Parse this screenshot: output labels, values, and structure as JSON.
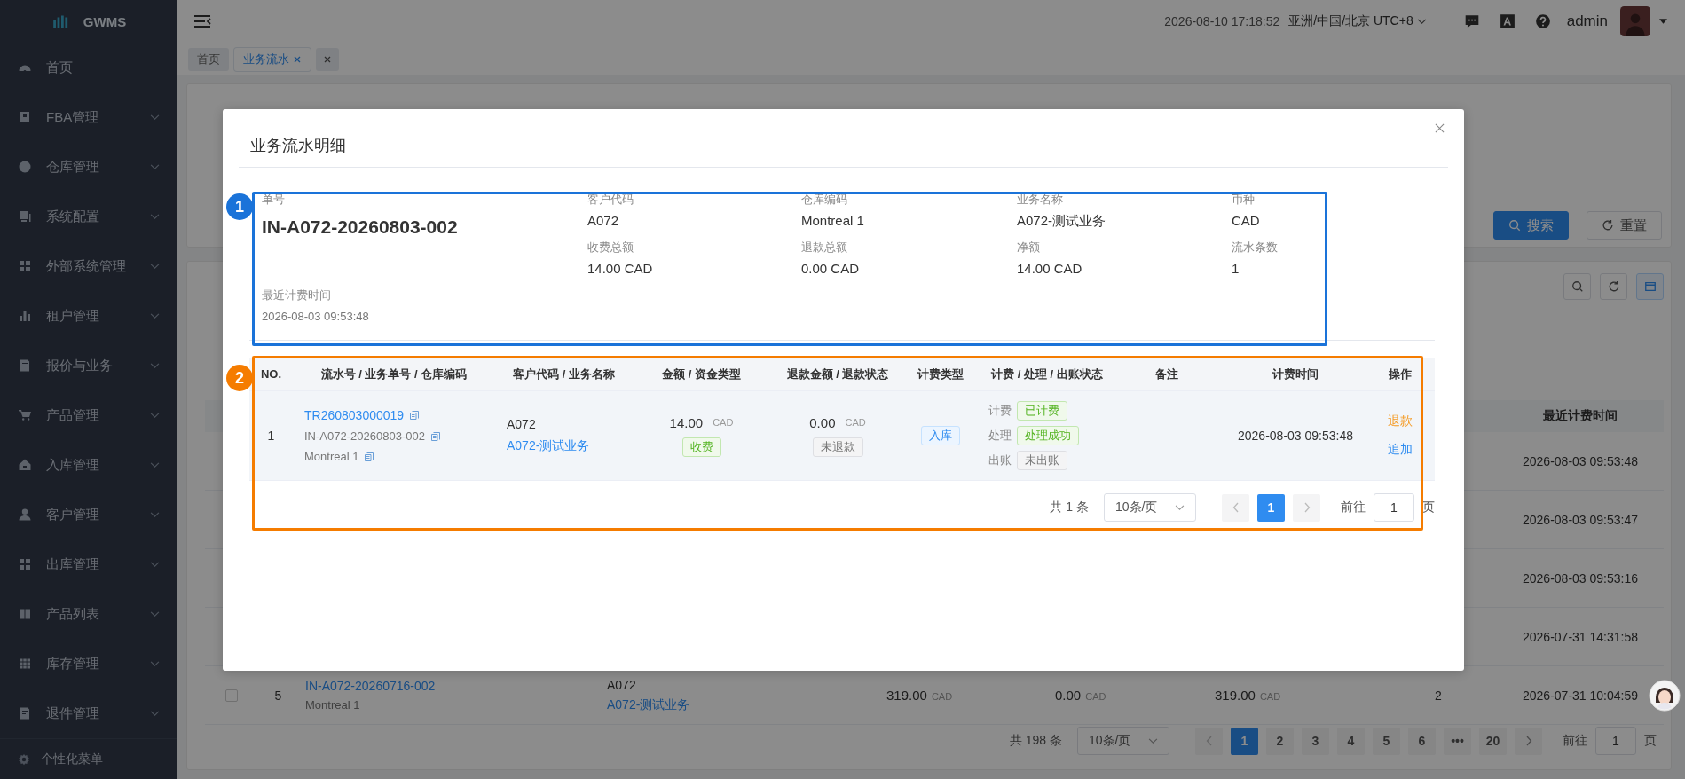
{
  "sidebar": {
    "logo": "GWMS",
    "items": [
      {
        "label": "首页",
        "has_children": false
      },
      {
        "label": "FBA管理",
        "has_children": true
      },
      {
        "label": "仓库管理",
        "has_children": true
      },
      {
        "label": "系统配置",
        "has_children": true
      },
      {
        "label": "外部系统管理",
        "has_children": true
      },
      {
        "label": "租户管理",
        "has_children": true
      },
      {
        "label": "报价与业务",
        "has_children": true
      },
      {
        "label": "产品管理",
        "has_children": true
      },
      {
        "label": "入库管理",
        "has_children": true
      },
      {
        "label": "客户管理",
        "has_children": true
      },
      {
        "label": "出库管理",
        "has_children": true
      },
      {
        "label": "产品列表",
        "has_children": true
      },
      {
        "label": "库存管理",
        "has_children": true
      },
      {
        "label": "退件管理",
        "has_children": true
      }
    ],
    "footer": "个性化菜单"
  },
  "header": {
    "datetime": "2026-08-10 17:18:52",
    "timezone": "亚洲/中国/北京 UTC+8",
    "user": "admin"
  },
  "tabs": [
    {
      "label": "首页",
      "selected": false,
      "closable": false
    },
    {
      "label": "业务流水",
      "selected": true,
      "closable": true
    }
  ],
  "filter_actions": [
    {
      "label": "搜索",
      "kind": "primary"
    },
    {
      "label": "重置",
      "kind": "default"
    }
  ],
  "list": {
    "time_column": "最近计费时间",
    "rows": [
      {
        "kind": "partial",
        "time": "2026-08-03 09:53:48"
      },
      {
        "kind": "partial",
        "time": "2026-08-03 09:53:47"
      },
      {
        "kind": "partial",
        "time": "2026-08-03 09:53:16"
      },
      {
        "kind": "partial",
        "time": "2026-07-31 14:31:58"
      },
      {
        "kind": "full",
        "checked": false,
        "no": "5",
        "order_no": "IN-A072-20260716-002",
        "warehouse": "Montreal 1",
        "customer_code": "A072",
        "business_name": "A072-测试业务",
        "amount": "319.00",
        "amount_currency": "CAD",
        "refund": "0.00",
        "refund_currency": "CAD",
        "net": "319.00",
        "net_currency": "CAD",
        "count": "2",
        "time": "2026-07-31 10:04:59"
      }
    ],
    "pagination": {
      "total": "共 198 条",
      "page_size": "10条/页",
      "pages": [
        {
          "label": "1",
          "selected": true
        },
        {
          "label": "2",
          "selected": false
        },
        {
          "label": "3",
          "selected": false
        },
        {
          "label": "4",
          "selected": false
        },
        {
          "label": "5",
          "selected": false
        },
        {
          "label": "6",
          "selected": false
        },
        {
          "label": "•••",
          "selected": false
        },
        {
          "label": "20",
          "selected": false
        }
      ],
      "goto_label": "前往",
      "goto_value": "1",
      "goto_suffix": "页"
    }
  },
  "modal": {
    "title": "业务流水明细",
    "summary": {
      "annotation": {
        "number": "1",
        "color": "#1a73d9"
      },
      "order_label": "单号",
      "order_value": "IN-A072-20260803-002",
      "fields": [
        {
          "label": "客户代码",
          "value": "A072"
        },
        {
          "label": "仓库编码",
          "value": "Montreal 1"
        },
        {
          "label": "业务名称",
          "value": "A072-测试业务"
        },
        {
          "label": "币种",
          "value": "CAD"
        },
        {
          "label": "收费总额",
          "value": "14.00 CAD"
        },
        {
          "label": "退款总额",
          "value": "0.00 CAD"
        },
        {
          "label": "净额",
          "value": "14.00 CAD"
        },
        {
          "label": "流水条数",
          "value": "1"
        }
      ],
      "last_label": "最近计费时间",
      "last_value": "2026-08-03 09:53:48"
    },
    "table": {
      "annotation": {
        "number": "2",
        "color": "#f57c00"
      },
      "columns": [
        "NO.",
        "流水号 / 业务单号 / 仓库编码",
        "客户代码 / 业务名称",
        "金额 / 资金类型",
        "退款金额 / 退款状态",
        "计费类型",
        "计费 / 处理 / 出账状态",
        "备注",
        "计费时间",
        "操作"
      ],
      "rows": [
        {
          "no": "1",
          "flow_no": "TR260803000019",
          "order_no": "IN-A072-20260803-002",
          "warehouse": "Montreal 1",
          "customer_code": "A072",
          "business_name": "A072-测试业务",
          "amount": "14.00",
          "amount_currency": "CAD",
          "fund_type": {
            "text": "收费",
            "kind": "success"
          },
          "refund_amount": "0.00",
          "refund_currency": "CAD",
          "refund_status": {
            "text": "未退款",
            "kind": "neutral"
          },
          "billing_type": {
            "text": "入库",
            "kind": "info"
          },
          "statuses": [
            {
              "label": "计费",
              "value": "已计费",
              "kind": "success"
            },
            {
              "label": "处理",
              "value": "处理成功",
              "kind": "success"
            },
            {
              "label": "出账",
              "value": "未出账",
              "kind": "neutral"
            }
          ],
          "billing_time": "2026-08-03 09:53:48",
          "actions": [
            {
              "label": "退款",
              "kind": "warning"
            },
            {
              "label": "追加",
              "kind": "primary"
            }
          ]
        }
      ]
    },
    "pagination": {
      "total": "共 1 条",
      "page_size": "10条/页",
      "pages": [
        {
          "label": "1",
          "selected": true
        }
      ],
      "goto_label": "前往",
      "goto_value": "1",
      "goto_suffix": "页"
    }
  }
}
